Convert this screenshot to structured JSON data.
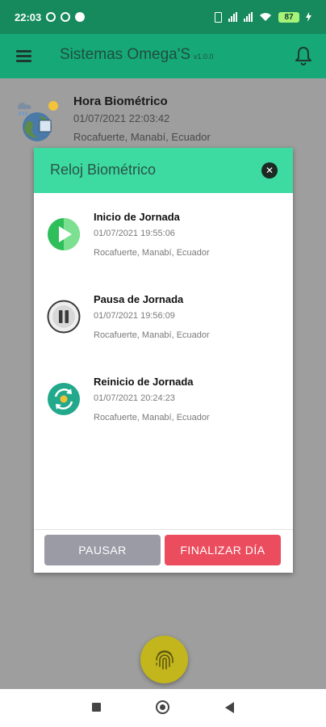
{
  "status_bar": {
    "time": "22:03",
    "battery": "87",
    "icons": [
      "alarm-icon",
      "whatsapp-icon",
      "app-icon",
      "vibrate-icon",
      "signal-icon",
      "signal-icon",
      "wifi-icon",
      "battery-icon",
      "charging-icon"
    ]
  },
  "app_bar": {
    "title": "Sistemas Omega'S",
    "version": "v1.0.0",
    "menu_icon": "menu-icon",
    "bell_icon": "bell-icon"
  },
  "background_card": {
    "title": "Hora Biométrico",
    "date": "01/07/2021 22:03:42",
    "location": "Rocafuerte, Manabí, Ecuador",
    "icon": "weather-earth-icon"
  },
  "modal": {
    "title": "Reloj Biométrico",
    "close_icon": "close-icon",
    "entries": [
      {
        "icon": "play-icon",
        "title": "Inicio de Jornada",
        "date": "01/07/2021 19:55:06",
        "location": "Rocafuerte, Manabí, Ecuador"
      },
      {
        "icon": "pause-icon",
        "title": "Pausa de Jornada",
        "date": "01/07/2021 19:56:09",
        "location": "Rocafuerte, Manabí, Ecuador"
      },
      {
        "icon": "restart-icon",
        "title": "Reinicio de Jornada",
        "date": "01/07/2021 20:24:23",
        "location": "Rocafuerte, Manabí, Ecuador"
      }
    ],
    "buttons": {
      "pause": "PAUSAR",
      "finish": "FINALIZAR DÍA"
    }
  },
  "fab": {
    "icon": "fingerprint-icon"
  },
  "nav_bar": {
    "icons": [
      "recents-icon",
      "home-icon",
      "back-icon"
    ]
  },
  "colors": {
    "status_bar": "#168a5c",
    "app_bar": "#17a878",
    "modal_header": "#3ddba1",
    "pause_button": "#9a9ba5",
    "finish_button": "#eb4d5e",
    "fab": "#c3b61c",
    "overlay": "#9e9e9e"
  }
}
